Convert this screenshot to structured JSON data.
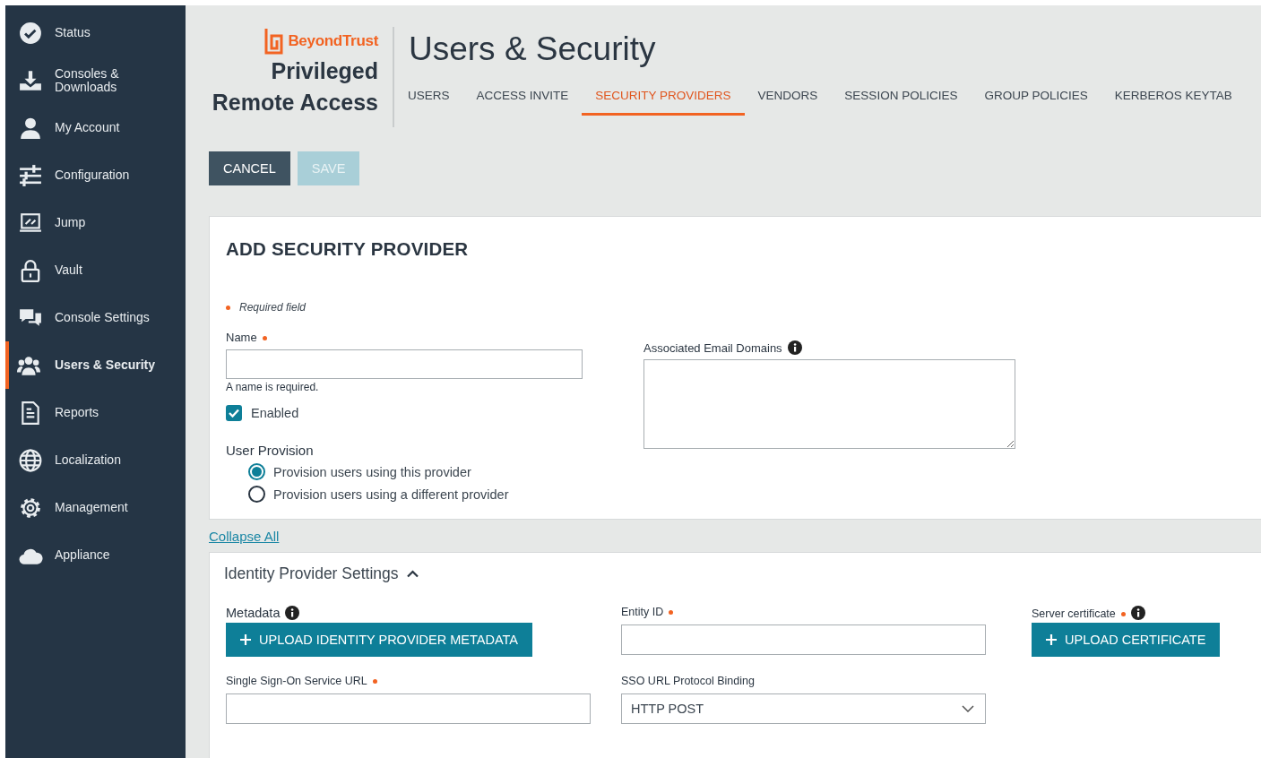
{
  "sidebar": {
    "items": [
      {
        "label": "Status",
        "selected": false
      },
      {
        "label": "Consoles & Downloads",
        "selected": false
      },
      {
        "label": "My Account",
        "selected": false
      },
      {
        "label": "Configuration",
        "selected": false
      },
      {
        "label": "Jump",
        "selected": false
      },
      {
        "label": "Vault",
        "selected": false
      },
      {
        "label": "Console Settings",
        "selected": false
      },
      {
        "label": "Users & Security",
        "selected": true
      },
      {
        "label": "Reports",
        "selected": false
      },
      {
        "label": "Localization",
        "selected": false
      },
      {
        "label": "Management",
        "selected": false
      },
      {
        "label": "Appliance",
        "selected": false
      }
    ]
  },
  "brand": {
    "company": "BeyondTrust",
    "product": [
      "Privileged",
      "Remote Access"
    ]
  },
  "page_title": "Users & Security",
  "tabs": [
    {
      "label": "USERS",
      "selected": false
    },
    {
      "label": "ACCESS INVITE",
      "selected": false
    },
    {
      "label": "SECURITY PROVIDERS",
      "selected": true
    },
    {
      "label": "VENDORS",
      "selected": false
    },
    {
      "label": "SESSION POLICIES",
      "selected": false
    },
    {
      "label": "GROUP POLICIES",
      "selected": false
    },
    {
      "label": "KERBEROS KEYTAB",
      "selected": false
    }
  ],
  "actions": [
    {
      "label": "CANCEL",
      "disabled": false
    },
    {
      "label": "SAVE",
      "disabled": true
    }
  ],
  "form": {
    "title": "ADD SECURITY PROVIDER",
    "required_legend": "Required field",
    "name": {
      "label": "Name",
      "required": true,
      "error": "A name is required."
    },
    "enabled": {
      "label": "Enabled",
      "checked": true
    },
    "user_provision": {
      "label": "User Provision",
      "options": [
        {
          "label": "Provision users using this provider",
          "selected": true
        },
        {
          "label": "Provision users using a different provider",
          "selected": false
        }
      ]
    },
    "email_domains": {
      "label": "Associated Email Domains",
      "info": true
    }
  },
  "collapse_all": "Collapse All",
  "idp": {
    "title": "Identity Provider Settings",
    "expanded": true,
    "fields": [
      {
        "kind": "upload",
        "label": "Metadata",
        "required": false,
        "info": true,
        "button": "UPLOAD IDENTITY PROVIDER METADATA"
      },
      {
        "kind": "text",
        "label": "Entity ID",
        "required": true,
        "info": false
      },
      {
        "kind": "upload",
        "label": "Server certificate",
        "required": true,
        "info": true,
        "button": "UPLOAD CERTIFICATE"
      },
      {
        "kind": "text",
        "label": "Single Sign-On Service URL",
        "required": true,
        "info": false
      },
      {
        "kind": "select",
        "label": "SSO URL Protocol Binding",
        "required": false,
        "info": false,
        "value": "HTTP POST"
      }
    ]
  }
}
